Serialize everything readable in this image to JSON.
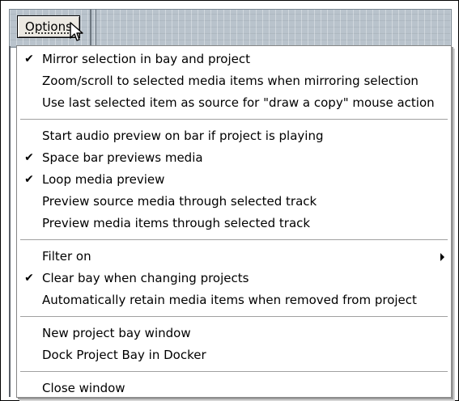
{
  "toolbar": {
    "options_label": "Options"
  },
  "menu": {
    "groups": [
      [
        {
          "label": "Mirror selection in bay and project",
          "checked": true
        },
        {
          "label": "Zoom/scroll to selected media items when mirroring selection",
          "checked": false
        },
        {
          "label": "Use last selected item as source for \"draw a copy\" mouse action",
          "checked": false
        }
      ],
      [
        {
          "label": "Start audio preview on bar if project is playing",
          "checked": false
        },
        {
          "label": "Space bar previews media",
          "checked": true
        },
        {
          "label": "Loop media preview",
          "checked": true
        },
        {
          "label": "Preview source media through selected track",
          "checked": false
        },
        {
          "label": "Preview media items through selected track",
          "checked": false
        }
      ],
      [
        {
          "label": "Filter on",
          "checked": false,
          "submenu": true
        },
        {
          "label": "Clear bay when changing projects",
          "checked": true
        },
        {
          "label": "Automatically retain media items when removed from project",
          "checked": false
        }
      ],
      [
        {
          "label": "New project bay window",
          "checked": false
        },
        {
          "label": "Dock Project Bay in Docker",
          "checked": false
        }
      ],
      [
        {
          "label": "Close window",
          "checked": false
        }
      ]
    ],
    "check_glyph": "✔",
    "icons": {
      "check": "checkmark-icon",
      "submenu": "submenu-arrow-icon",
      "cursor": "mouse-pointer-icon"
    }
  }
}
